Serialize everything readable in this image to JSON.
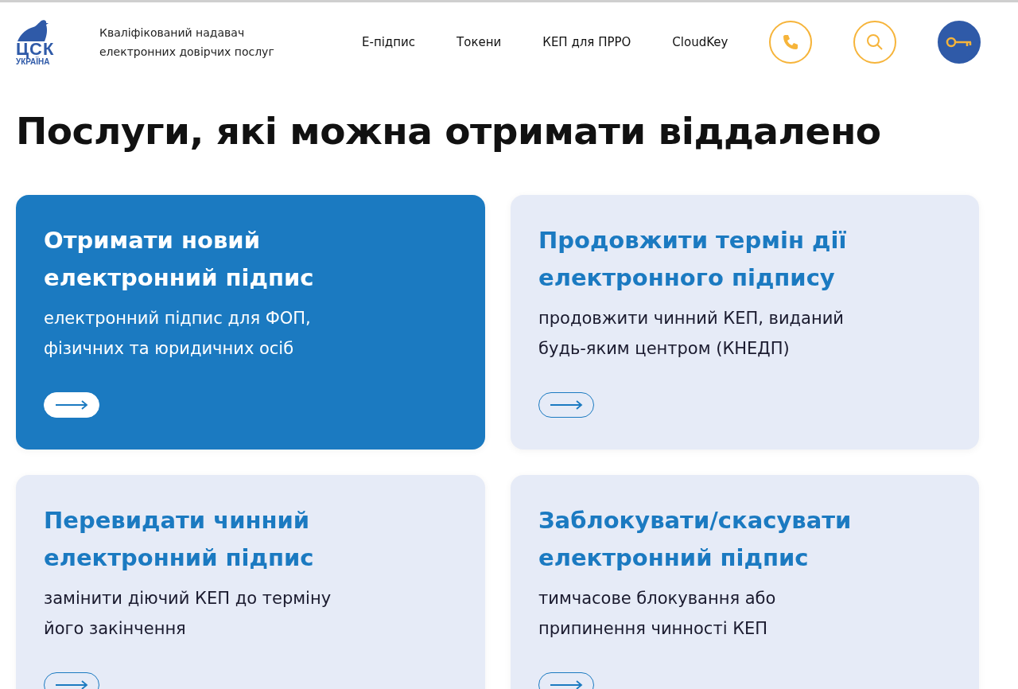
{
  "header": {
    "logo": {
      "mark": "ЦСК",
      "sub": "УКРАЇНА"
    },
    "tagline": "Кваліфікований надавач\nелектронних довірчих послуг",
    "nav": [
      "Е-підпис",
      "Токени",
      "КЕП для ПРРО",
      "CloudKey"
    ],
    "actions": [
      {
        "kind": "phone"
      },
      {
        "kind": "search"
      },
      {
        "kind": "key"
      }
    ]
  },
  "title": "Послуги, які можна отримати віддалено",
  "cards": [
    {
      "title": "Отримати новий\nелектронний підпис",
      "text": "електронний підпис для ФОП,\nфізичних та юридичних осіб",
      "selected": true
    },
    {
      "title": "Продовжити термін дії\nелектронного підпису",
      "text": "продовжити чинний КЕП, виданий\nбудь-яким центром (КНЕДП)",
      "selected": false
    },
    {
      "title": "Перевидати чинний\nелектронний підпис",
      "text": "замінити діючий КЕП до терміну\nйого закінчення",
      "selected": false
    },
    {
      "title": "Заблокувати/скасувати\nелектронний підпис",
      "text": "тимчасове блокування або\nприпинення чинності КЕП",
      "selected": false
    }
  ]
}
